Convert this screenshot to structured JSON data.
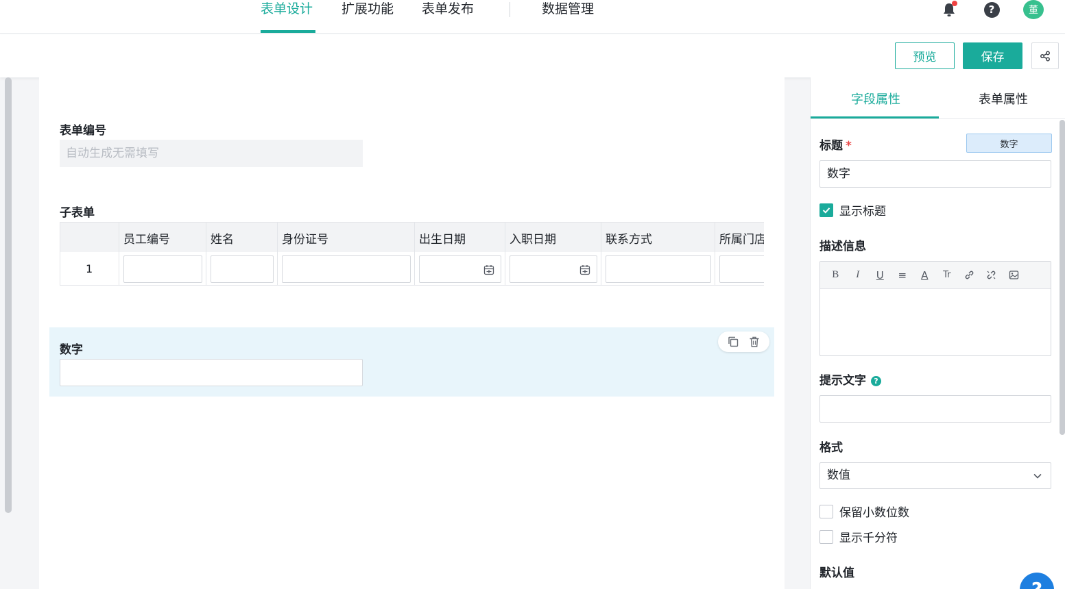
{
  "nav": {
    "tabs": [
      {
        "label": "表单设计",
        "active": true
      },
      {
        "label": "扩展功能",
        "active": false
      },
      {
        "label": "表单发布",
        "active": false
      },
      {
        "label": "数据管理",
        "active": false
      }
    ],
    "help_glyph": "?",
    "avatar_text": "董",
    "icons": [
      "bell-icon",
      "help-icon"
    ]
  },
  "toolbar": {
    "preview_label": "预览",
    "save_label": "保存"
  },
  "form": {
    "code_label": "表单编号",
    "code_placeholder": "自动生成无需填写",
    "subtable_label": "子表单",
    "subtable_columns": [
      "员工编号",
      "姓名",
      "身份证号",
      "出生日期",
      "入职日期",
      "联系方式",
      "所属门店"
    ],
    "subtable_row_index": "1",
    "number_label": "数字"
  },
  "panel": {
    "tabs": [
      "字段属性",
      "表单属性"
    ],
    "title_label": "标题",
    "required_mark": "*",
    "type_badge": "数字",
    "title_value": "数字",
    "show_title_label": "显示标题",
    "show_title_checked": true,
    "desc_label": "描述信息",
    "editor_tools": [
      "B",
      "I",
      "U",
      "≡",
      "A",
      "Tr",
      "link",
      "unlink",
      "image"
    ],
    "hint_label": "提示文字",
    "format_label": "格式",
    "format_value": "数值",
    "keep_decimal_label": "保留小数位数",
    "keep_decimal_checked": false,
    "thousand_sep_label": "显示千分符",
    "thousand_sep_checked": false,
    "default_label": "默认值",
    "float_help_glyph": "?"
  },
  "colors": {
    "accent": "#1aab9b",
    "selected_bg": "#e8f5fb",
    "badge_bg": "#dcecfb"
  }
}
